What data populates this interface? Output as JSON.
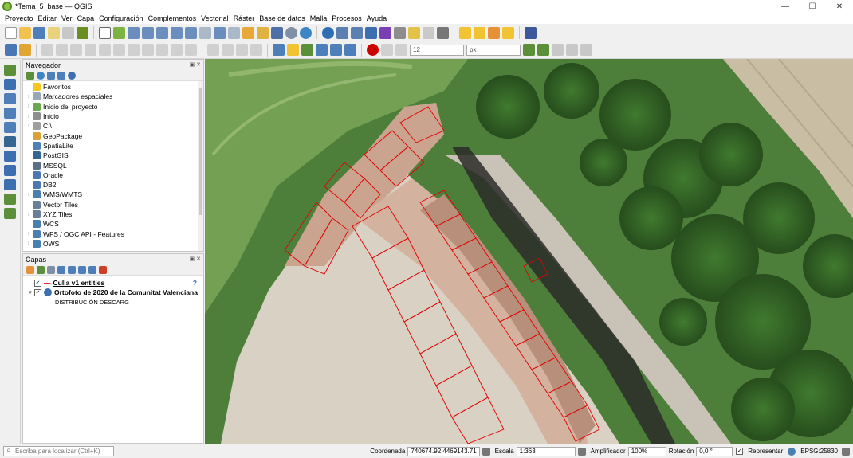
{
  "window": {
    "title": "*Tema_5_base — QGIS",
    "minimize": "—",
    "maximize": "☐",
    "close": "✕"
  },
  "menu": [
    "Proyecto",
    "Editar",
    "Ver",
    "Capa",
    "Configuración",
    "Complementos",
    "Vectorial",
    "Ráster",
    "Base de datos",
    "Malla",
    "Procesos",
    "Ayuda"
  ],
  "toolbar2": {
    "size_value": "12",
    "unit_value": "px"
  },
  "navigator": {
    "title": "Navegador",
    "items": [
      {
        "label": "Favoritos",
        "icon": "star-icon",
        "color": "#f3c623",
        "expand": false
      },
      {
        "label": "Marcadores espaciales",
        "icon": "bookmark-icon",
        "color": "#9aa7b5",
        "expand": true
      },
      {
        "label": "Inicio del proyecto",
        "icon": "project-home-icon",
        "color": "#6aa84f",
        "expand": true
      },
      {
        "label": "Inicio",
        "icon": "home-folder-icon",
        "color": "#8d8d8d",
        "expand": true
      },
      {
        "label": "C:\\",
        "icon": "drive-icon",
        "color": "#9e9e9e",
        "expand": true
      },
      {
        "label": "GeoPackage",
        "icon": "geopackage-icon",
        "color": "#d8a13a",
        "expand": false
      },
      {
        "label": "SpatiaLite",
        "icon": "spatialite-icon",
        "color": "#4f7fb8",
        "expand": false
      },
      {
        "label": "PostGIS",
        "icon": "postgis-icon",
        "color": "#336791",
        "expand": false
      },
      {
        "label": "MSSQL",
        "icon": "mssql-icon",
        "color": "#5b6f8a",
        "expand": false
      },
      {
        "label": "Oracle",
        "icon": "oracle-icon",
        "color": "#4e78b4",
        "expand": false
      },
      {
        "label": "DB2",
        "icon": "db2-icon",
        "color": "#4e78b4",
        "expand": false
      },
      {
        "label": "WMS/WMTS",
        "icon": "globe-icon",
        "color": "#4a7fb0",
        "expand": true
      },
      {
        "label": "Vector Tiles",
        "icon": "vector-tiles-icon",
        "color": "#6a7d99",
        "expand": false
      },
      {
        "label": "XYZ Tiles",
        "icon": "grid-icon",
        "color": "#6a7d99",
        "expand": true
      },
      {
        "label": "WCS",
        "icon": "wcs-icon",
        "color": "#4a7fb0",
        "expand": false
      },
      {
        "label": "WFS / OGC API - Features",
        "icon": "wfs-icon",
        "color": "#4a7fb0",
        "expand": true
      },
      {
        "label": "OWS",
        "icon": "ows-icon",
        "color": "#4a7fb0",
        "expand": true
      }
    ]
  },
  "layers_panel": {
    "title": "Capas",
    "layers": [
      {
        "name": "Culla v1 entities",
        "checked": true,
        "legend_marker": "—",
        "help": "?"
      },
      {
        "name": "Ortofoto de 2020 de la Comunitat Valenciana",
        "checked": true,
        "sublabel": "DISTRIBUCIÓN DESCARG"
      }
    ]
  },
  "status": {
    "locator_placeholder": "Escriba para localizar (Ctrl+K)",
    "coord_label": "Coordenada",
    "coord_value": "740674.92,4469143.71",
    "scale_label": "Escala",
    "scale_value": "1:363",
    "magnifier_label": "Amplificador",
    "magnifier_value": "100%",
    "rotation_label": "Rotación",
    "rotation_value": "0,0 °",
    "render_label": "Representar",
    "crs": "EPSG:25830"
  }
}
